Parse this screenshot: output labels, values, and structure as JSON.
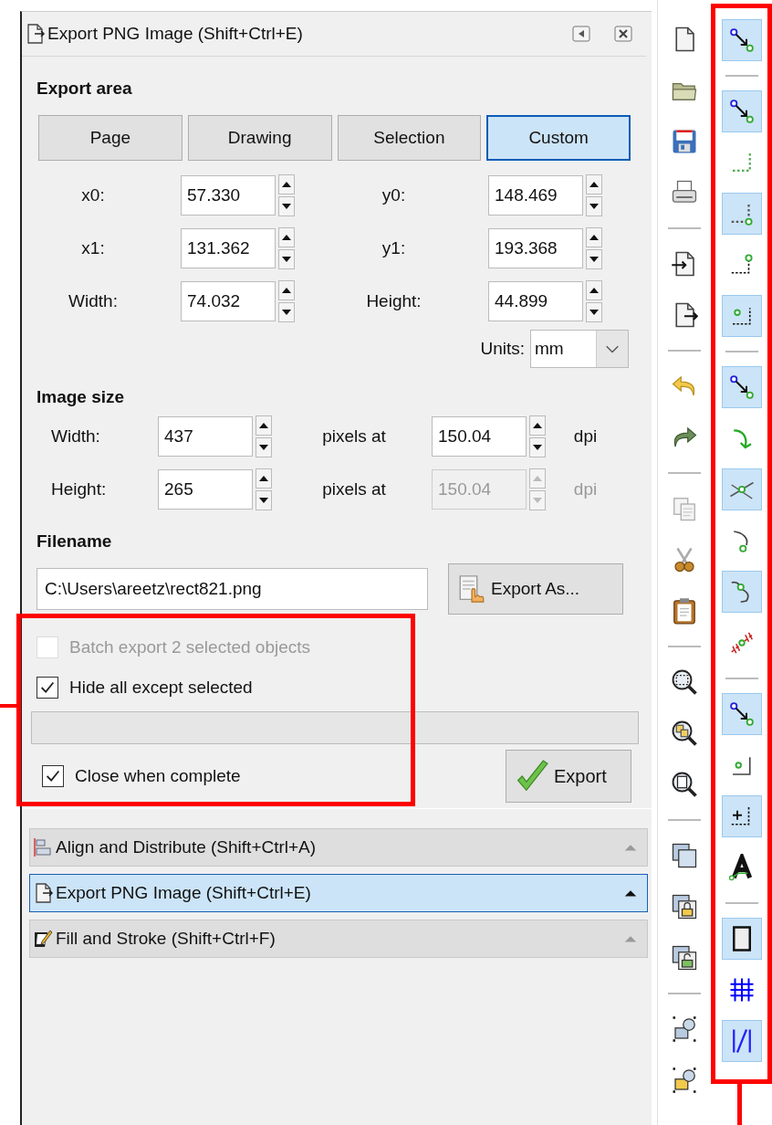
{
  "dock_header": {
    "title": "Export PNG Image (Shift+Ctrl+E)"
  },
  "export_area": {
    "heading": "Export area",
    "modes": [
      {
        "label": "Page",
        "selected": false
      },
      {
        "label": "Drawing",
        "selected": false
      },
      {
        "label": "Selection",
        "selected": false
      },
      {
        "label": "Custom",
        "selected": true
      }
    ],
    "coordinates": [
      {
        "label": "x0:",
        "value": "57.330"
      },
      {
        "label": "y0:",
        "value": "148.469"
      },
      {
        "label": "x1:",
        "value": "131.362"
      },
      {
        "label": "y1:",
        "value": "193.368"
      },
      {
        "label": "Width:",
        "value": "74.032"
      },
      {
        "label": "Height:",
        "value": "44.899"
      }
    ],
    "units": {
      "label": "Units:",
      "value": "mm"
    }
  },
  "image_size": {
    "heading": "Image size",
    "rows": [
      {
        "label": "Width:",
        "value": "437",
        "middle": "pixels at",
        "dpi_value": "150.04",
        "unit": "dpi",
        "disabled": false
      },
      {
        "label": "Height:",
        "value": "265",
        "middle": "pixels at",
        "dpi_value": "150.04",
        "unit": "dpi",
        "disabled": true
      }
    ]
  },
  "filename": {
    "heading": "Filename",
    "value": "C:\\Users\\areetz\\rect821.png",
    "button": "Export As..."
  },
  "options": [
    {
      "label": "Batch export 2 selected objects",
      "checked": false,
      "disabled": true
    },
    {
      "label": "Hide all except selected",
      "checked": true,
      "disabled": false
    }
  ],
  "close_option": {
    "label": "Close when complete",
    "checked": true
  },
  "export_button": {
    "label": "Export"
  },
  "dock_panels": [
    {
      "title": "Align and Distribute (Shift+Ctrl+A)",
      "kind": "align",
      "selected": false
    },
    {
      "title": "Export PNG Image (Shift+Ctrl+E)",
      "kind": "export",
      "selected": true
    },
    {
      "title": "Fill and Stroke (Shift+Ctrl+F)",
      "kind": "fill",
      "selected": false
    }
  ],
  "commands_toolbar": [
    {
      "kind": "button"
    },
    {
      "kind": "button"
    },
    {
      "kind": "button"
    },
    {
      "kind": "button"
    },
    {
      "kind": "separator"
    },
    {
      "kind": "button"
    },
    {
      "kind": "button"
    },
    {
      "kind": "separator"
    },
    {
      "kind": "button"
    },
    {
      "kind": "button"
    },
    {
      "kind": "separator"
    },
    {
      "kind": "button"
    },
    {
      "kind": "button"
    },
    {
      "kind": "button"
    },
    {
      "kind": "separator"
    },
    {
      "kind": "button"
    },
    {
      "kind": "button"
    },
    {
      "kind": "button"
    },
    {
      "kind": "separator"
    },
    {
      "kind": "button"
    },
    {
      "kind": "button"
    },
    {
      "kind": "button"
    },
    {
      "kind": "separator"
    },
    {
      "kind": "button"
    },
    {
      "kind": "button"
    }
  ],
  "snap_toolbar": [
    {
      "kind": "button",
      "on": true
    },
    {
      "kind": "separator"
    },
    {
      "kind": "button",
      "on": true
    },
    {
      "kind": "button",
      "on": false
    },
    {
      "kind": "button",
      "on": true
    },
    {
      "kind": "button",
      "on": false
    },
    {
      "kind": "button",
      "on": true
    },
    {
      "kind": "separator"
    },
    {
      "kind": "button",
      "on": true
    },
    {
      "kind": "button",
      "on": false
    },
    {
      "kind": "button",
      "on": true
    },
    {
      "kind": "button",
      "on": false
    },
    {
      "kind": "button",
      "on": true
    },
    {
      "kind": "button",
      "on": false
    },
    {
      "kind": "separator"
    },
    {
      "kind": "button",
      "on": true
    },
    {
      "kind": "button",
      "on": false
    },
    {
      "kind": "button",
      "on": true
    },
    {
      "kind": "button",
      "on": false
    },
    {
      "kind": "separator"
    },
    {
      "kind": "button",
      "on": true
    },
    {
      "kind": "button",
      "on": false
    },
    {
      "kind": "button",
      "on": true
    }
  ],
  "highlights": {
    "options_framed": true,
    "snap_toolbar_framed": true
  }
}
